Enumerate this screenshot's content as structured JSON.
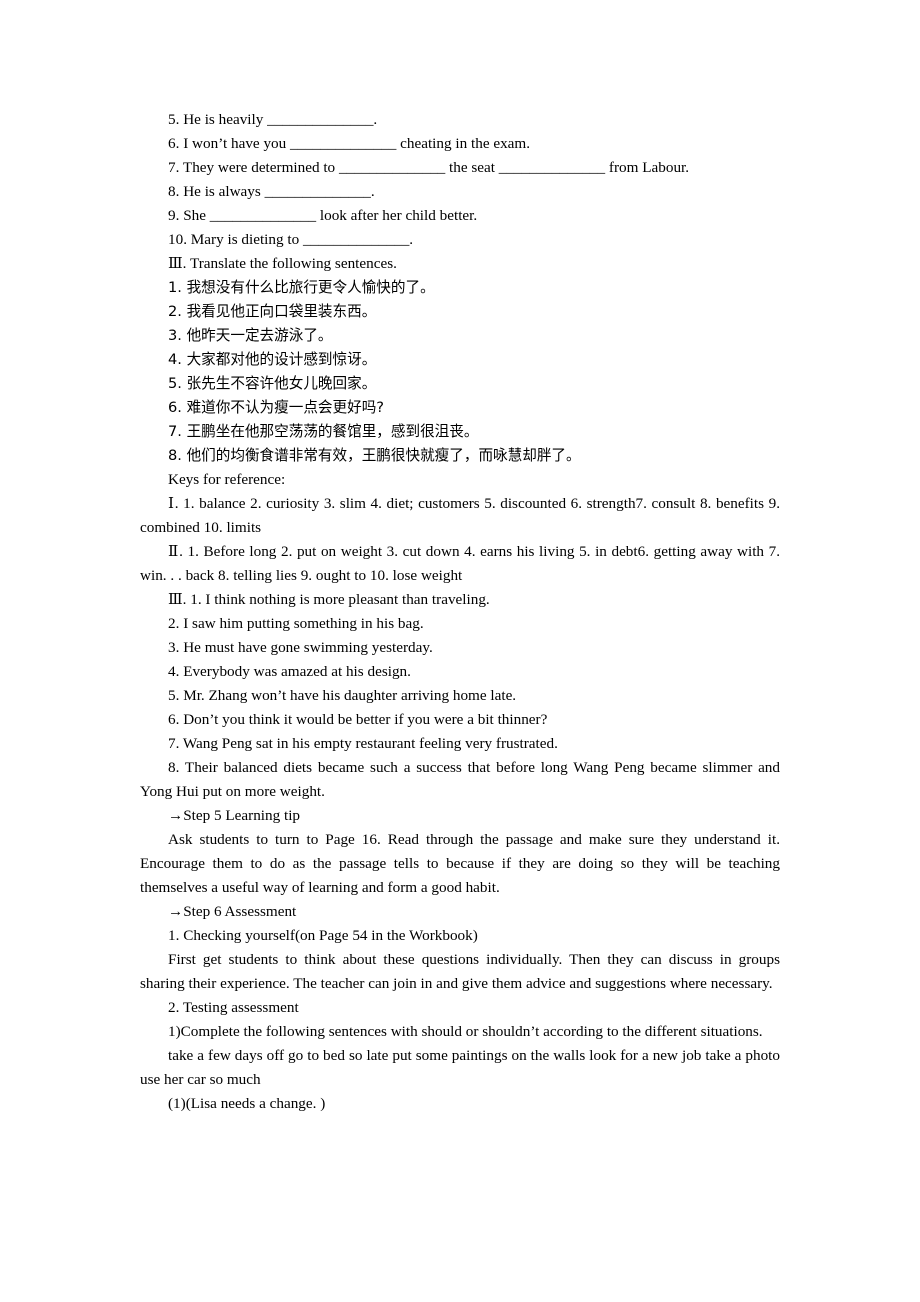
{
  "document": {
    "section_exercise_ii_items": [
      "5. He is heavily ______________.",
      "6. I won’t have you ______________ cheating in the exam.",
      "7. They were determined to ______________ the seat ______________ from Labour.",
      "8. He is always ______________.",
      "9. She ______________ look after her child better.",
      "10. Mary is dieting to ______________."
    ],
    "section_iii_heading": "Ⅲ. Translate the following sentences.",
    "section_iii_items": [
      "1. 我想没有什么比旅行更令人愉快的了。",
      "2. 我看见他正向口袋里装东西。",
      "3. 他昨天一定去游泳了。",
      "4. 大家都对他的设计感到惊讶。",
      "5. 张先生不容许他女儿晚回家。",
      "6. 难道你不认为瘦一点会更好吗?",
      "7. 王鹏坐在他那空荡荡的餐馆里，感到很沮丧。",
      "8. 他们的均衡食谱非常有效，王鹏很快就瘦了，而咏慧却胖了。"
    ],
    "keys_heading": "Keys for reference:",
    "keys_i": "Ⅰ. 1. balance    2. curiosity    3. slim    4. diet; customers    5. discounted    6. strength7. consult    8. benefits    9. combined    10. limits",
    "keys_ii": "Ⅱ. 1. Before long    2. put on weight    3. cut down    4. earns his living    5. in debt6. getting away with    7. win. . . back    8. telling lies    9. ought to    10. lose weight",
    "keys_iii_items": [
      "Ⅲ. 1. I think nothing is more pleasant than traveling.",
      "2. I saw him putting something in his bag.",
      "3. He must have gone swimming yesterday.",
      "4. Everybody was amazed at his design.",
      "5. Mr. Zhang won’t have his daughter arriving home late.",
      "6. Don’t you think it would be better if you were a bit thinner?",
      "7. Wang Peng sat in his empty restaurant feeling very frustrated."
    ],
    "keys_iii_item8": "8. Their balanced diets became such a success that before long Wang Peng became slimmer and Yong Hui put on more weight.",
    "step5_heading": "→Step 5 Learning tip",
    "step5_paragraph": "Ask students to turn to Page 16. Read through the passage and make sure they understand it. Encourage them to do as the passage tells to because if they are doing so they will be teaching themselves a useful way of learning and form a good habit.",
    "step6_heading": "→Step 6 Assessment",
    "step6_item1_heading": "1. Checking yourself(on Page 54 in the Workbook)",
    "step6_item1_paragraph": "First get students to think about these questions individually. Then they can discuss in groups sharing their experience. The teacher can join in and give them advice and suggestions where necessary.",
    "step6_item2_heading": "2. Testing assessment",
    "step6_item2_sub1": "1)Complete the following sentences with should or shouldn’t according to the different situations.",
    "word_bank": "take a few days off    go to bed so late    put some paintings on the walls    look for a new job take a photo    use her car so much",
    "question1": "(1)(Lisa needs a change. )"
  }
}
